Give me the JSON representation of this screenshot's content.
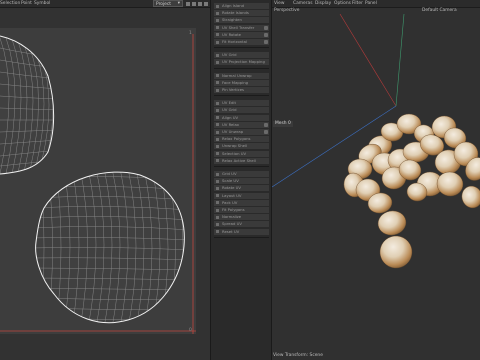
{
  "uv_editor": {
    "menu": [
      "Selection",
      "Point",
      "Symbol"
    ],
    "mode_select": "Project",
    "axis_top": "1",
    "axis_bottom": "0"
  },
  "tool_panel": {
    "groups": [
      [
        "Align Island",
        "Rotate Islands",
        "Straighten",
        "UV Shell Transfer",
        "UV Rotate",
        "Fit Horizontal"
      ],
      [
        "UV Grid",
        "UV Projection Mapping"
      ],
      [
        "Normal Unwrap",
        "Face Mapping",
        "Pin Vertices"
      ],
      [
        "UV Edit",
        "UV Grid",
        "Align UV",
        "UV Relax",
        "UV Unwrap",
        "Relax Polygons",
        "Unwrap Shell",
        "Selection UV",
        "Relax Active Shell"
      ],
      [
        "Grid UV",
        "Scale UV",
        "Rotate UV",
        "Layout UV",
        "Pack UV",
        "Fit Polygons",
        "Normalize",
        "Spread UV",
        "Reset UV"
      ]
    ]
  },
  "viewport": {
    "menu": [
      "View",
      "Cameras",
      "Display",
      "Options",
      "Filter",
      "Panel"
    ],
    "view_label": "Perspective",
    "camera_label": "Default Camera",
    "mesh_tag": "Mesh 0",
    "status": "View Transform: Scene"
  },
  "colors": {
    "uv_background": "#3d3d3d",
    "uv_boundary_red": "#c2463e",
    "axis_red": "#b23a3a",
    "axis_green": "#3e9a6e",
    "axis_blue": "#3c6fc2",
    "pebble_tint": "#e4d4bb"
  }
}
